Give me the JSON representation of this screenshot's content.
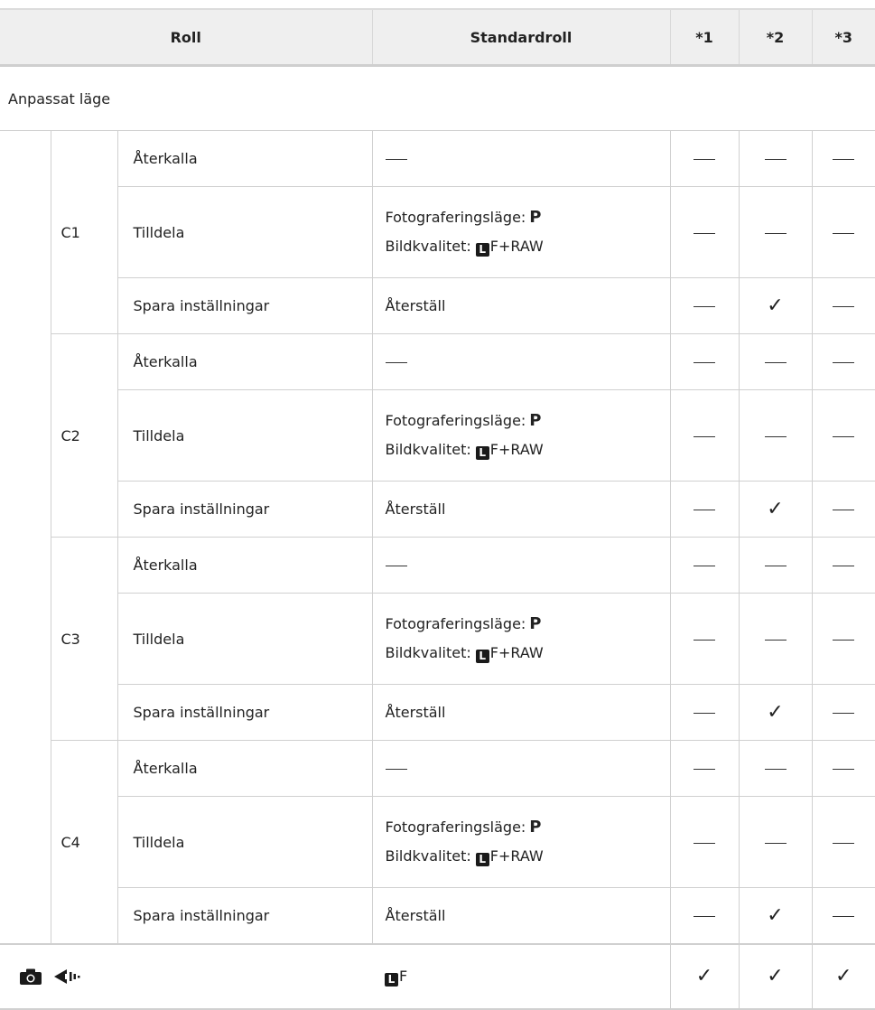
{
  "header": {
    "roll": "Roll",
    "standardroll": "Standardroll",
    "f1": "*1",
    "f2": "*2",
    "f3": "*3"
  },
  "section_title": "Anpassat läge",
  "labels": {
    "recall": "Återkalla",
    "assign": "Tilldela",
    "save": "Spara inställningar",
    "shoot_mode": "Fotograferingsläge:",
    "shoot_mode_value": "P",
    "quality": "Bildkvalitet:",
    "quality_icon": "L",
    "quality_value": "F+RAW",
    "reset": "Återställ"
  },
  "groups": [
    {
      "name": "C1"
    },
    {
      "name": "C2"
    },
    {
      "name": "C3"
    },
    {
      "name": "C4"
    }
  ],
  "last_row": {
    "icons": [
      "camera-icon",
      "sequential-shooting-icon"
    ],
    "quality_icon": "L",
    "quality_value": "F"
  }
}
